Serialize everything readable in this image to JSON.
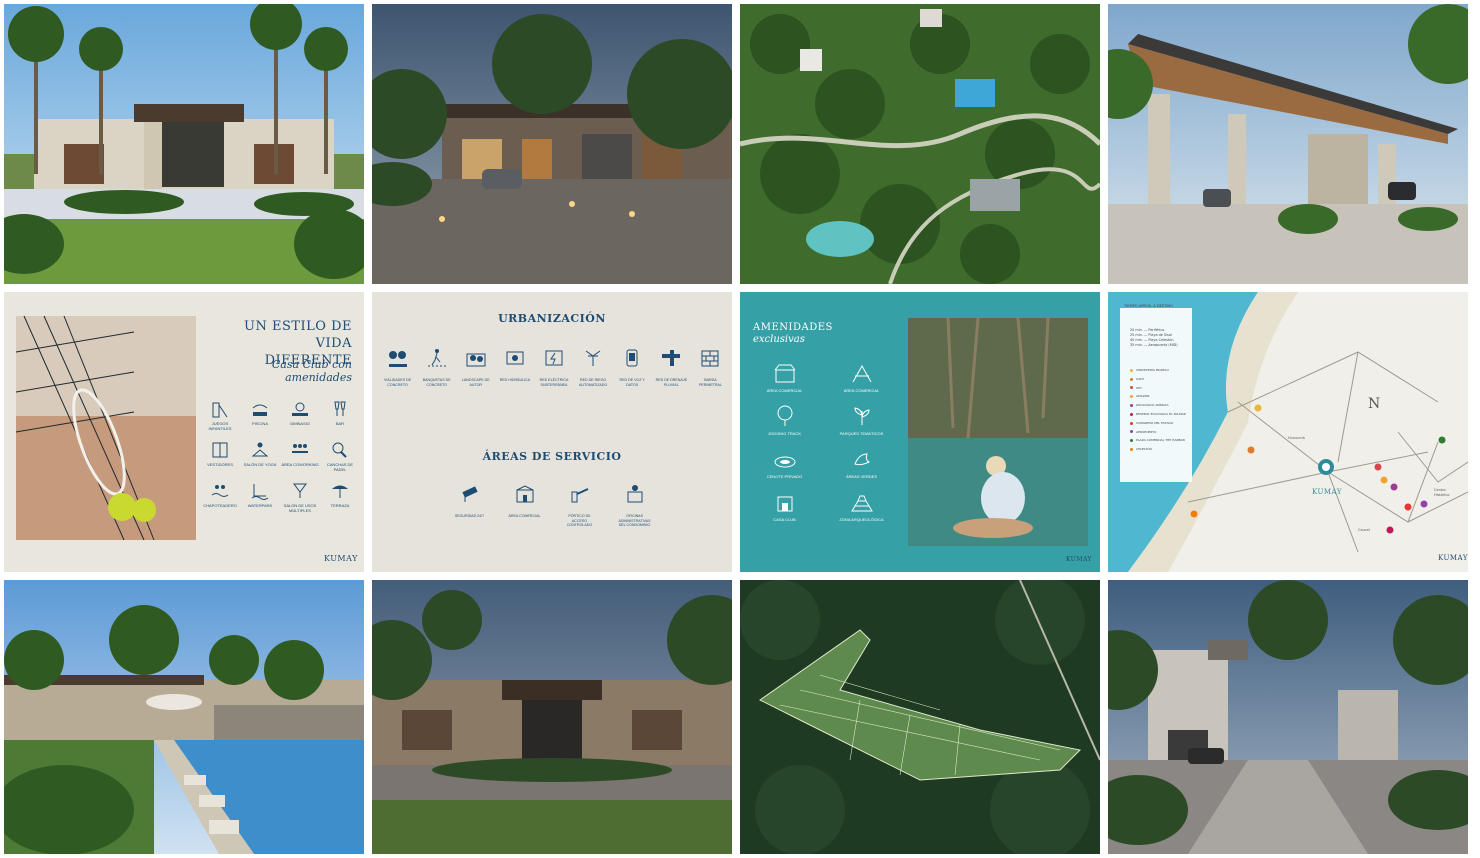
{
  "slide_estilo": {
    "title_line1": "UN ESTILO DE",
    "title_line2": "VIDA DIFERENTE",
    "subtitle_line1": "Casa Club con",
    "subtitle_line2": "amenidades",
    "amenities": [
      {
        "icon": "playground-icon",
        "label": "JUEGOS INFANTILES"
      },
      {
        "icon": "pool-icon",
        "label": "PISCINA"
      },
      {
        "icon": "gym-icon",
        "label": "GIMNASIO"
      },
      {
        "icon": "bar-icon",
        "label": "BAR"
      },
      {
        "icon": "lockers-icon",
        "label": "VESTIDORES"
      },
      {
        "icon": "yoga-icon",
        "label": "SALÓN DE YOGA"
      },
      {
        "icon": "coworking-icon",
        "label": "ÁREA COWORKING"
      },
      {
        "icon": "paddle-icon",
        "label": "CANCHAS DE PADEL"
      },
      {
        "icon": "wading-pool-icon",
        "label": "CHAPOTEADERO"
      },
      {
        "icon": "waterpark-icon",
        "label": "WATERPARK"
      },
      {
        "icon": "events-icon",
        "label": "SALÓN DE USOS MÚLTIPLES"
      },
      {
        "icon": "terrace-icon",
        "label": "TERRAZA"
      }
    ],
    "brand": "KUMAY"
  },
  "slide_urbanizacion": {
    "heading_urbanizacion": "URBANIZACIÓN",
    "urbanizacion_items": [
      {
        "icon": "sidewalk-icon",
        "label": "VIALIDADES DE CONCRETO"
      },
      {
        "icon": "walkway-icon",
        "label": "BANQUETAS DE CONCRETO"
      },
      {
        "icon": "landscape-icon",
        "label": "LANDSCAPE DE AUTOR"
      },
      {
        "icon": "hydraulic-icon",
        "label": "RED HIDRÁULICA"
      },
      {
        "icon": "electric-icon",
        "label": "RED ELÉCTRICA SUBTERRÁNEA"
      },
      {
        "icon": "irrigation-icon",
        "label": "RED DE RIEGO AUTOMATIZADO"
      },
      {
        "icon": "voice-data-icon",
        "label": "RED DE VOZ Y DATOS"
      },
      {
        "icon": "drainage-icon",
        "label": "RED DE DRENAJE PLUVIAL"
      },
      {
        "icon": "wall-icon",
        "label": "BARDA PERIMETRAL"
      }
    ],
    "heading_servicio": "ÁREAS DE SERVICIO",
    "servicio_items": [
      {
        "icon": "security-camera-icon",
        "label": "SEGURIDAD 24/7"
      },
      {
        "icon": "commercial-icon",
        "label": "ÁREA COMERCIAL"
      },
      {
        "icon": "gate-icon",
        "label": "PÓRTICO DE ACCESO CONTROLADO"
      },
      {
        "icon": "office-icon",
        "label": "OFICINAS ADMINISTRATIVAS DEL CONDOMINIO"
      }
    ]
  },
  "slide_amenidades": {
    "title": "AMENIDADES",
    "subtitle": "exclusivas",
    "items": [
      {
        "icon": "shop-icon",
        "label": "ÁREA COMERCIAL"
      },
      {
        "icon": "picnic-icon",
        "label": "ÁREA COMERCIAL"
      },
      {
        "icon": "tree-icon",
        "label": "JOGGING TRACK"
      },
      {
        "icon": "plant-icon",
        "label": "PARQUES TEMÁTICOS"
      },
      {
        "icon": "cenote-icon",
        "label": "CENOTE PRIVADO"
      },
      {
        "icon": "bird-icon",
        "label": "ÁREAS VERDES"
      },
      {
        "icon": "clubhouse-icon",
        "label": "CASA CLUB"
      },
      {
        "icon": "pyramid-icon",
        "label": "ZONA ARQUEOLÓGICA"
      }
    ],
    "brand": "KUMAY"
  },
  "slide_mapa": {
    "header": "TIEMPO APROX. A DESTINO",
    "distances": [
      "20 min. — Periférico",
      "25 min. — Playa de Sisal",
      "40 min. — Playa Celestún",
      "35 min. — Aeropuerto (MID)"
    ],
    "legend": [
      {
        "label": "CERVECERÍA MODELO",
        "color": "#e6b93c"
      },
      {
        "label": "UADY",
        "color": "#e07b2a"
      },
      {
        "label": "UPY",
        "color": "#d64550"
      },
      {
        "label": "AMAZON",
        "color": "#f0a330"
      },
      {
        "label": "ZOOLÓGICO ANIMAYA",
        "color": "#9b3f8c"
      },
      {
        "label": "RESERVA ECOLÓGICA EL PALMAR",
        "color": "#c2185b"
      },
      {
        "label": "CONGRESO DEL ESTADO",
        "color": "#e53935"
      },
      {
        "label": "AEROPUERTO",
        "color": "#8e44ad"
      },
      {
        "label": "PLAZA COMERCIAL THE HARBOR",
        "color": "#2e7d32"
      },
      {
        "label": "CELESTÚN",
        "color": "#f57c00"
      }
    ],
    "places": [
      "Hunucmá",
      "Caucel",
      "Centro Histórico"
    ],
    "logo_label": "KUMAY",
    "compass": "N",
    "brand": "KUMAY"
  },
  "photos": [
    {
      "name": "photo-clubhouse-day"
    },
    {
      "name": "photo-commercial-night"
    },
    {
      "name": "photo-aerial-park"
    },
    {
      "name": "photo-entrance-gate"
    },
    {
      "name": "photo-pool-terrace"
    },
    {
      "name": "photo-clubhouse-dusk"
    },
    {
      "name": "photo-aerial-masterplan"
    },
    {
      "name": "photo-residential-street"
    }
  ]
}
